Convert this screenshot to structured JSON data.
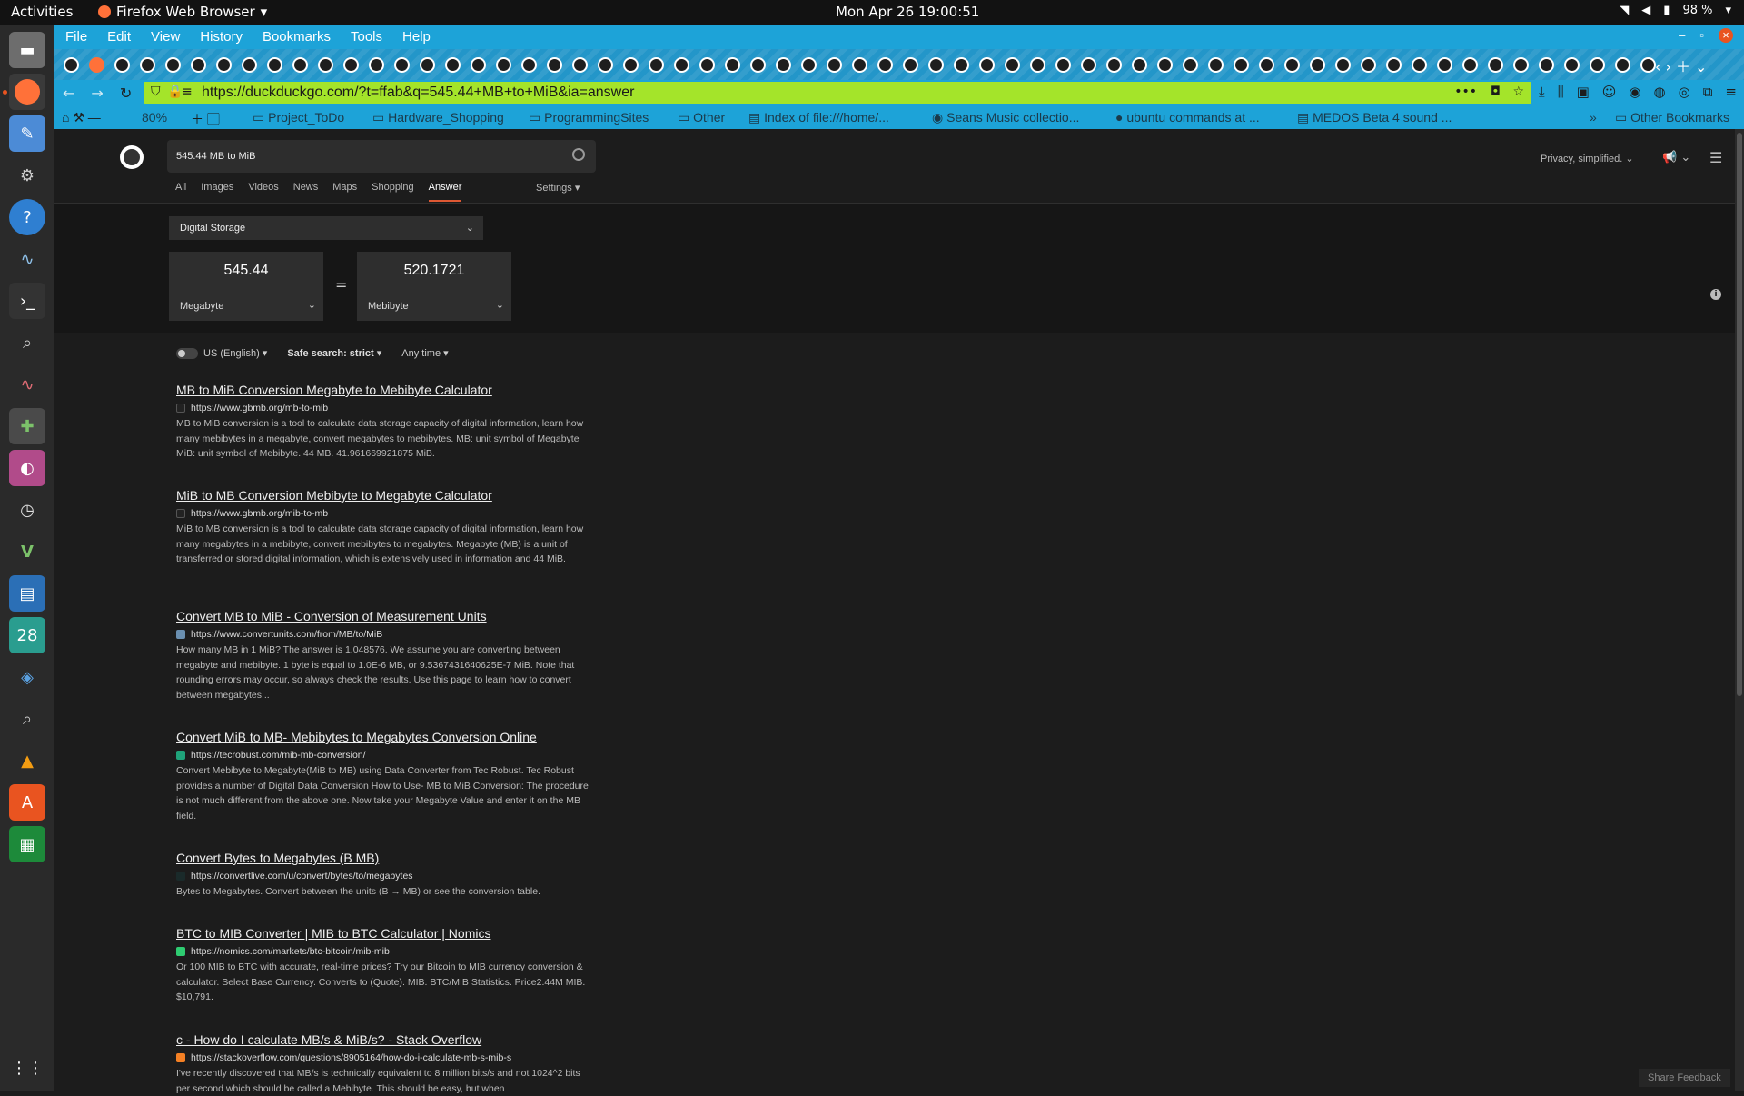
{
  "system": {
    "activities": "Activities",
    "app_name": "Firefox Web Browser",
    "clock": "Mon Apr 26  19:00:51",
    "battery": "98 %"
  },
  "menu": [
    "File",
    "Edit",
    "View",
    "History",
    "Bookmarks",
    "Tools",
    "Help"
  ],
  "url": "https://duckduckgo.com/?t=ffab&q=545.44+MB+to+MiB&ia=answer",
  "zoom": "80%",
  "bookmarks": [
    "Project_ToDo",
    "Hardware_Shopping",
    "ProgrammingSites",
    "Other",
    "Index of file:///home/...",
    "Seans Music collectio...",
    "ubuntu commands at ...",
    "MEDOS Beta 4 sound ...",
    "Other Bookmarks"
  ],
  "search": {
    "query": "545.44 MB to MiB"
  },
  "tabs": [
    "All",
    "Images",
    "Videos",
    "News",
    "Maps",
    "Shopping",
    "Answer"
  ],
  "settings_label": "Settings",
  "privacy_label": "Privacy, simplified.",
  "converter": {
    "category": "Digital Storage",
    "left_value": "545.44",
    "left_unit": "Megabyte",
    "equals": "=",
    "right_value": "520.1721",
    "right_unit": "Mebibyte"
  },
  "filters": {
    "region": "US (English)",
    "safe_search": "Safe search: strict",
    "time": "Any time"
  },
  "results": [
    {
      "title": "MB to MiB Conversion Megabyte to Mebibyte Calculator",
      "url": "https://www.gbmb.org/mb-to-mib",
      "snippet": "MB to MiB conversion is a tool to calculate data storage capacity of digital information, learn how many mebibytes in a megabyte, convert megabytes to mebibytes. MB: unit symbol of Megabyte MiB: unit symbol of Mebibyte. 44 MB. 41.961669921875 MiB."
    },
    {
      "title": "MiB to MB Conversion Mebibyte to Megabyte Calculator",
      "url": "https://www.gbmb.org/mib-to-mb",
      "snippet": "MiB to MB conversion is a tool to calculate data storage capacity of digital information, learn how many megabytes in a mebibyte, convert mebibytes to megabytes. Megabyte (MB) is a unit of transferred or stored digital information, which is extensively used in information and 44 MiB."
    },
    {
      "title": "Convert MB to MiB - Conversion of Measurement Units",
      "url": "https://www.convertunits.com/from/MB/to/MiB",
      "snippet": "How many MB in 1 MiB? The answer is 1.048576. We assume you are converting between megabyte and mebibyte. 1 byte is equal to 1.0E-6 MB, or 9.5367431640625E-7 MiB. Note that rounding errors may occur, so always check the results. Use this page to learn how to convert between megabytes..."
    },
    {
      "title": "Convert MiB to MB- Mebibytes to Megabytes Conversion Online",
      "url": "https://tecrobust.com/mib-mb-conversion/",
      "snippet": "Convert Mebibyte to Megabyte(MiB to MB) using Data Converter from Tec Robust. Tec Robust provides a number of Digital Data Conversion How to Use- MB to MiB Conversion: The procedure is not much different from the above one. Now take your Megabyte Value and enter it on the MB field."
    },
    {
      "title": "Convert Bytes to Megabytes (B MB)",
      "url": "https://convertlive.com/u/convert/bytes/to/megabytes",
      "snippet": "Bytes to Megabytes. Convert between the units (B → MB) or see the conversion table."
    },
    {
      "title": "BTC to MIB Converter | MIB to BTC Calculator | Nomics",
      "url": "https://nomics.com/markets/btc-bitcoin/mib-mib",
      "snippet": "Or 100 MIB to BTC with accurate, real-time prices? Try our Bitcoin to MIB currency conversion & calculator. Select Base Currency. Converts to (Quote). MIB. BTC/MIB Statistics. Price2.44M MIB. $10,791."
    },
    {
      "title": "c - How do I calculate MB/s & MiB/s? - Stack Overflow",
      "url": "https://stackoverflow.com/questions/8905164/how-do-i-calculate-mb-s-mib-s",
      "snippet": "I've recently discovered that MB/s is technically equivalent to 8 million bits/s and not 1024^2 bits per second which should be called a Mebibyte. This should be easy, but when"
    }
  ],
  "feedback": "Share Feedback",
  "colors": {
    "accent": "#1da3d8",
    "url_bg": "#a4e42a",
    "ddg_orange": "#de5833"
  }
}
